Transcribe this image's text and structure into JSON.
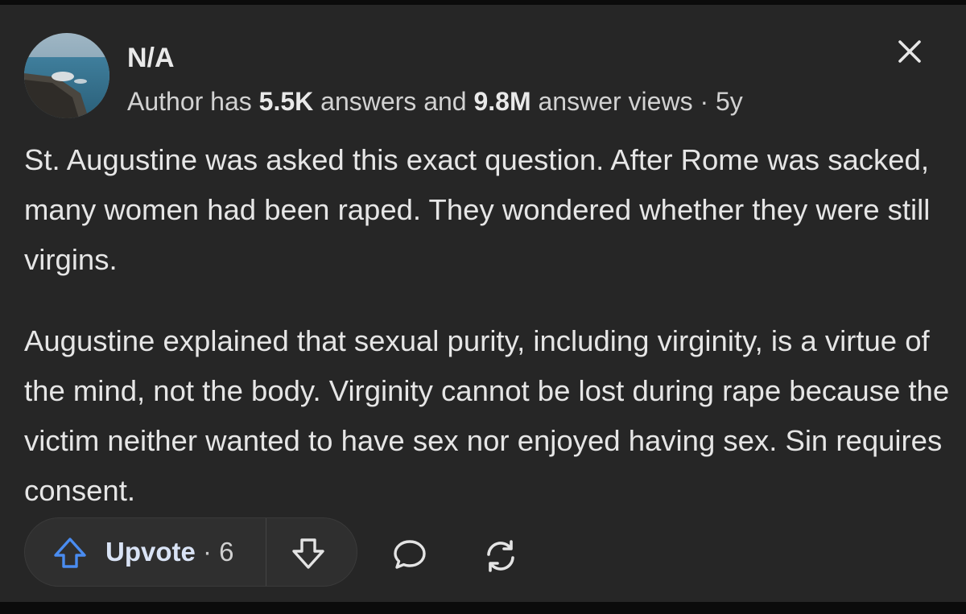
{
  "author": {
    "name": "N/A",
    "meta_prefix": "Author has ",
    "answers_count": "5.5K",
    "answers_text": " answers and ",
    "views_count": "9.8M",
    "views_text": " answer views · 5y",
    "avatar_icon": "avatar-photo"
  },
  "answer": {
    "paragraphs": [
      "St. Augustine was asked this exact question. After Rome was sacked, many women had been raped. They wondered whether they were still virgins.",
      "Augustine explained that sexual purity, including virginity, is a virtue of the mind, not the body. Virginity cannot be lost during rape because the victim neither wanted to have sex nor enjoyed having sex. Sin requires consent."
    ]
  },
  "actions": {
    "upvote_label": "Upvote",
    "upvote_separator": " · ",
    "upvote_count": "6",
    "downvote_icon": "arrow-down-icon",
    "comment_icon": "comment-icon",
    "share_icon": "share-icon",
    "close_icon": "close-icon"
  },
  "colors": {
    "background": "#262626",
    "text": "#e6e6e6",
    "upvote_blue": "#4a8cf0",
    "pill": "#2f2f2f"
  }
}
